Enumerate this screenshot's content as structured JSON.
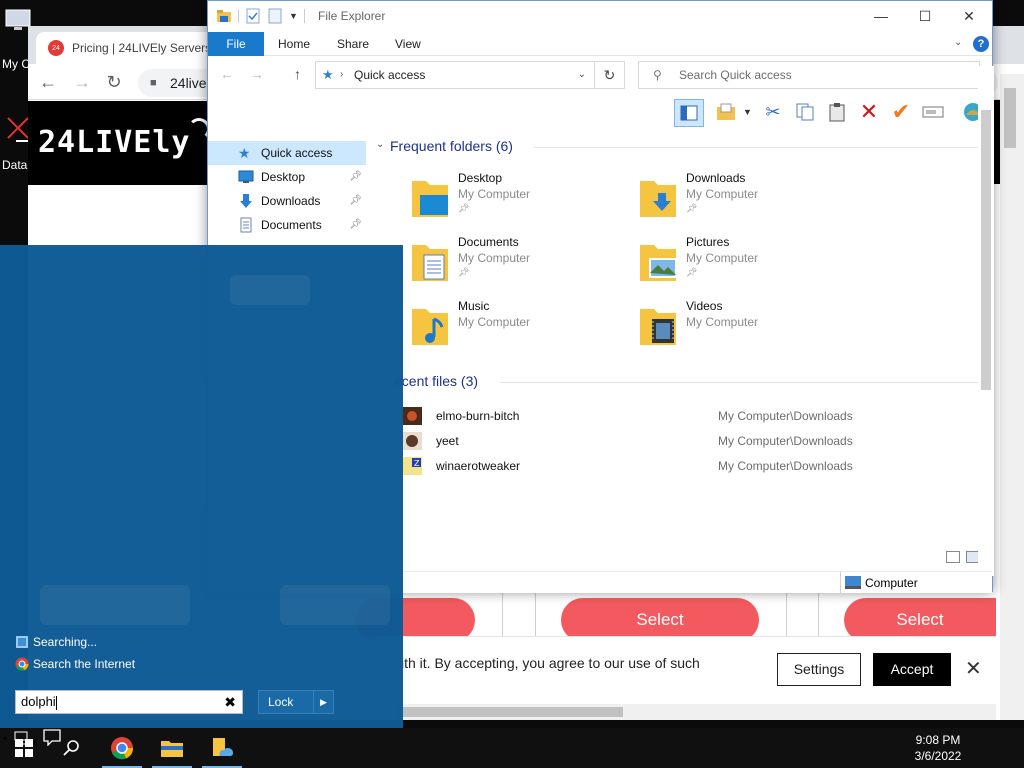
{
  "desktop": {
    "icons": [
      {
        "label": "My C"
      },
      {
        "label": "Data"
      }
    ]
  },
  "chrome": {
    "tab_title": "Pricing | 24LIVEly Servers",
    "tab_favicon_text": "24",
    "url": "24live",
    "hero_logo": "24LIVEly",
    "select_labels": [
      "Select",
      "Select"
    ],
    "cookie_text": "ith it. By accepting, you agree to our use of such",
    "settings_label": "Settings",
    "accept_label": "Accept",
    "close_glyph": "✕"
  },
  "explorer": {
    "title": "File Explorer",
    "ribbon_tabs": [
      "File",
      "Home",
      "Share",
      "View"
    ],
    "address": "Quick access",
    "search_placeholder": "Search Quick access",
    "nav": [
      {
        "label": "Quick access",
        "icon": "star-icon"
      },
      {
        "label": "Desktop",
        "icon": "desktop-icon"
      },
      {
        "label": "Downloads",
        "icon": "downloads-icon"
      },
      {
        "label": "Documents",
        "icon": "documents-icon"
      }
    ],
    "frequent_heading": "Frequent folders (6)",
    "folders": [
      {
        "name": "Desktop",
        "location": "My Computer"
      },
      {
        "name": "Downloads",
        "location": "My Computer"
      },
      {
        "name": "Documents",
        "location": "My Computer"
      },
      {
        "name": "Pictures",
        "location": "My Computer"
      },
      {
        "name": "Music",
        "location": "My Computer"
      },
      {
        "name": "Videos",
        "location": "My Computer"
      }
    ],
    "recent_heading": "ecent files (3)",
    "recent": [
      {
        "name": "elmo-burn-bitch",
        "path": "My Computer\\Downloads"
      },
      {
        "name": "yeet",
        "path": "My Computer\\Downloads"
      },
      {
        "name": "winaerotweaker",
        "path": "My Computer\\Downloads"
      }
    ],
    "status": "Computer"
  },
  "start_menu": {
    "searching": "Searching...",
    "search_internet": "Search the Internet",
    "query": "dolphi",
    "lock_label": "Lock"
  },
  "taskbar": {
    "time": "9:08 PM",
    "date": "3/6/2022"
  },
  "colors": {
    "start_bg": "#0f5b95",
    "ribbon_file": "#1979ca",
    "select_btn": "#f25a5f",
    "folder_yellow": "#f5c542"
  }
}
